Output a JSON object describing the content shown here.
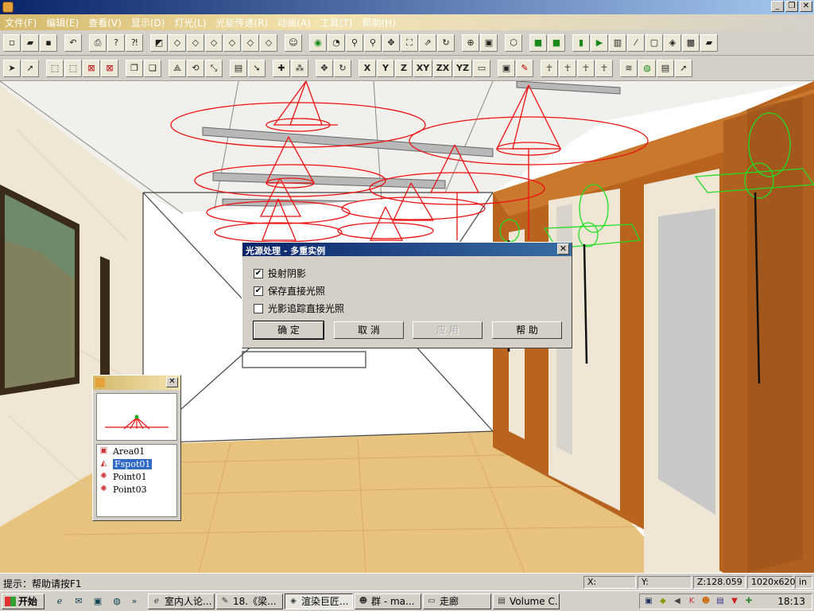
{
  "window": {
    "title": "",
    "controls": [
      "_",
      "❐",
      "✕"
    ]
  },
  "menu": [
    "文件(F)",
    "编辑(E)",
    "查看(V)",
    "显示(D)",
    "灯光(L)",
    "光能传递(R)",
    "动画(A)",
    "工具(T)",
    "帮助(H)"
  ],
  "toolbar2_axes": [
    "X",
    "Y",
    "Z",
    "XY",
    "ZX",
    "YZ"
  ],
  "dialog": {
    "title": "光源处理 - 多重实例",
    "checks": [
      {
        "label": "投射阴影",
        "checked": true
      },
      {
        "label": "保存直接光照",
        "checked": true
      },
      {
        "label": "光影追踪直接光照",
        "checked": false
      }
    ],
    "buttons": {
      "ok": "确 定",
      "cancel": "取 消",
      "apply": "应 用",
      "help": "帮 助"
    }
  },
  "light_panel": {
    "items": [
      "Area01",
      "Fspot01",
      "Point01",
      "Point03"
    ],
    "selected_index": 1
  },
  "status": {
    "hint": "提示：帮助请按F1",
    "x_label": "X:",
    "y_label": "Y:",
    "z_value": "Z:128.059",
    "resolution": "1020x620",
    "unit": "in"
  },
  "taskbar": {
    "start": "开始",
    "tasks": [
      "室内人论...",
      "18.《梁...",
      "渲染巨匠...",
      "群 - ma...",
      "走廊",
      "Volume C..."
    ],
    "active_index": 2,
    "clock": "18:13"
  },
  "colors": {
    "light_wire": "#ee1111",
    "fixture_wire": "#22dd22",
    "floor": "#e6c07a",
    "wood": "#b8641e"
  }
}
